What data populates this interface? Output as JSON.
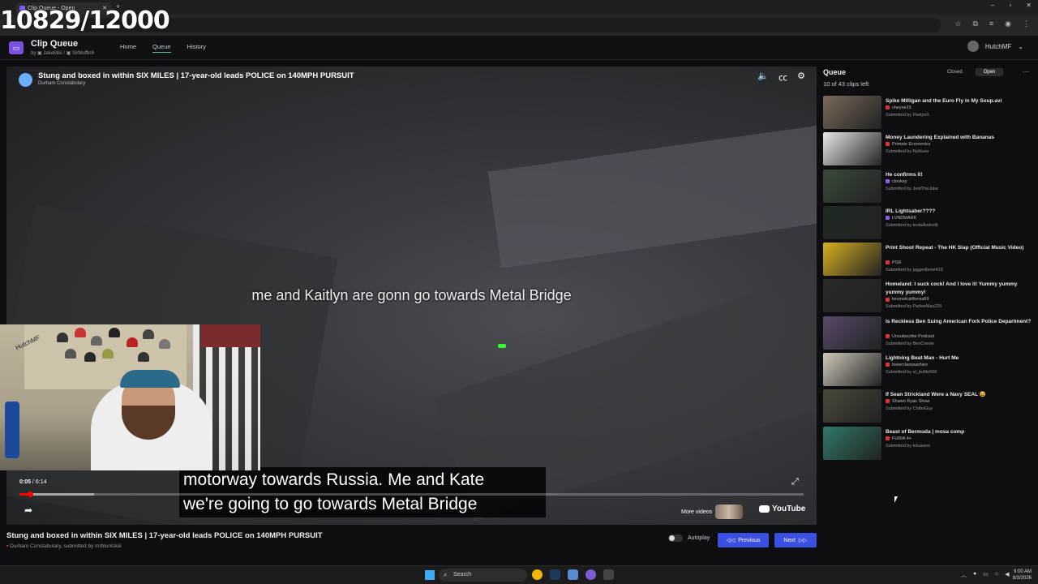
{
  "overlay_counter": "10829/12000",
  "browser": {
    "tab_title": "Clip Queue - Open"
  },
  "header": {
    "app_title": "Clip Queue",
    "by_text": "by",
    "mod1": "JakeMiki",
    "mod2": "SirMuffin9",
    "nav": [
      "Home",
      "Queue",
      "History"
    ],
    "username": "HutchMF"
  },
  "player": {
    "title": "Stung and boxed in within SIX MILES | 17-year-old leads POLICE on 140MPH PURSUIT",
    "channel": "Durham Constabulary",
    "subtitle_top": "me and Kaitlyn are gonn  go towards Metal Bridge",
    "subtitle_line1": "motorway towards Russia. Me and Kate",
    "subtitle_line2": "we're going to go towards Metal Bridge",
    "time_current": "0:05",
    "time_total": "6:14",
    "progress": 0.013,
    "buffered": 0.095,
    "more_videos": "More videos",
    "youtube": "YouTube"
  },
  "webcam": {
    "label": "HutchMF"
  },
  "below": {
    "title": "Stung and boxed in within SIX MILES | 17-year-old leads POLICE on 140MPH PURSUIT",
    "channel": "Durham Constabulary",
    "submitted": ", submitted by",
    "submitter": "mrbluntskiii",
    "autoplay": "Autoplay",
    "prev": "Previous",
    "next": "Next"
  },
  "queue": {
    "heading": "Queue",
    "count": "10 of 43 clips left",
    "closed": "Closed",
    "open": "Open",
    "items": [
      {
        "title": "Spike Milligan and the Euro Fly in My Soup.avi",
        "channel": "cheyne15",
        "submitter": "PastyxX",
        "platform": "youtube",
        "thumb": "#7a6a5a"
      },
      {
        "title": "Money Laundering Explained with Bananas",
        "channel": "Primate Economics",
        "submitter": "Nyhluss",
        "platform": "youtube",
        "thumb": "#e8e8e8"
      },
      {
        "title": "He confirms it!",
        "channel": "clookey",
        "submitter": "JestTheJoke",
        "platform": "twitch",
        "thumb": "#3a4a3a"
      },
      {
        "title": "IRL Lightsaber????",
        "channel": "LVNDMARK",
        "submitter": "kodaAndrettl",
        "platform": "twitch",
        "thumb": "#1f2a22"
      },
      {
        "title": "Print Shoot Repeat - The HK Slap (Official Music Video)",
        "channel": "PSR",
        "submitter": "jaggedbowl420",
        "platform": "youtube",
        "thumb": "#d8b020"
      },
      {
        "title": "Homeland: I suck cock! And I love it! Yummy yummy yummy yummy!",
        "channel": "kevinofcalifornia69",
        "submitter": "ParkerMax226",
        "platform": "youtube",
        "thumb": "#2a2a2a"
      },
      {
        "title": "Is Reckless Ben Suing American Fork Police Department?",
        "channel": "Unsubscribe Podcast",
        "submitter": "BenCreole",
        "platform": "youtube",
        "thumb": "#5a4a6a"
      },
      {
        "title": "Lightning Beat Man - Hurt Me",
        "channel": "lowerclasswarfare",
        "submitter": "el_bullte666",
        "platform": "youtube",
        "thumb": "#cfc8b8"
      },
      {
        "title": "If Sean Strickland Were a Navy SEAL 😆",
        "channel": "Shawn Ryan Show",
        "submitter": "ChiboGuy",
        "platform": "youtube",
        "thumb": "#4a4a3a"
      },
      {
        "title": "Beast of Bermuda | mosa comp",
        "channel": "FURIA 4+",
        "submitter": "kiluawoo",
        "platform": "youtube",
        "thumb": "#2f7a6a"
      }
    ]
  },
  "taskbar": {
    "search": "Search",
    "time": "9:00 AM",
    "date": "8/3/2026"
  }
}
